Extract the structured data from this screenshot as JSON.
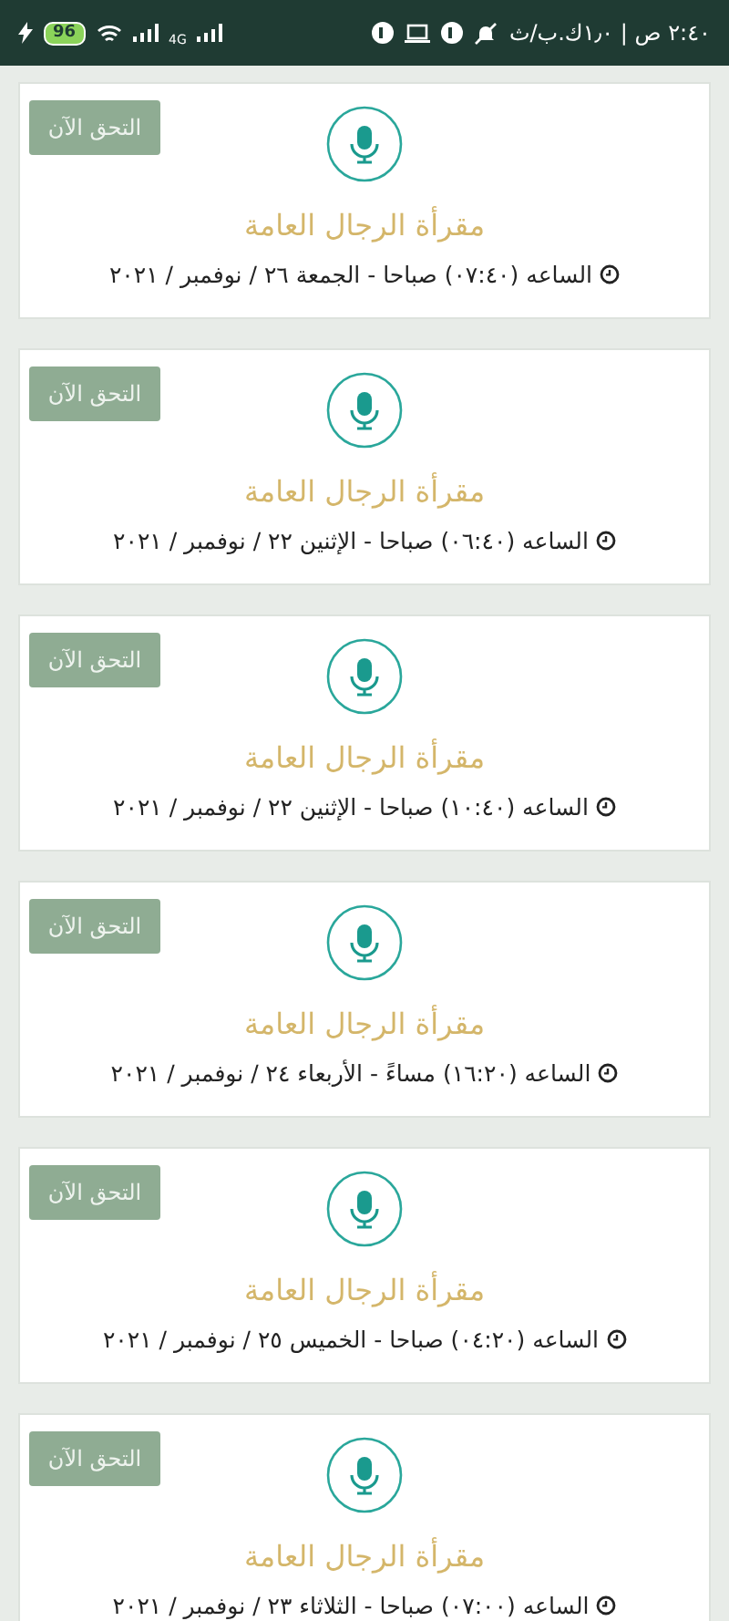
{
  "status_bar": {
    "time": "٢:٤٠ ص | ١٫٠ك.ب/ث",
    "battery": "96",
    "network": "4G"
  },
  "cards": [
    {
      "button": "التحق الآن",
      "title": "مقرأة الرجال العامة",
      "schedule": "الساعه (٠٧:٤٠) صباحا - الجمعة ٢٦ / نوفمبر / ٢٠٢١"
    },
    {
      "button": "التحق الآن",
      "title": "مقرأة الرجال العامة",
      "schedule": "الساعه (٠٦:٤٠) صباحا - الإثنين ٢٢ / نوفمبر / ٢٠٢١"
    },
    {
      "button": "التحق الآن",
      "title": "مقرأة الرجال العامة",
      "schedule": "الساعه (١٠:٤٠) صباحا - الإثنين ٢٢ / نوفمبر / ٢٠٢١"
    },
    {
      "button": "التحق الآن",
      "title": "مقرأة الرجال العامة",
      "schedule": "الساعه (١٦:٢٠) مساءً - الأربعاء ٢٤ / نوفمبر / ٢٠٢١"
    },
    {
      "button": "التحق الآن",
      "title": "مقرأة الرجال العامة",
      "schedule": "الساعه (٠٤:٢٠) صباحا - الخميس ٢٥ / نوفمبر / ٢٠٢١"
    },
    {
      "button": "التحق الآن",
      "title": "مقرأة الرجال العامة",
      "schedule": "الساعه (٠٧:٠٠) صباحا - الثلاثاء ٢٣ / نوفمبر / ٢٠٢١"
    }
  ]
}
